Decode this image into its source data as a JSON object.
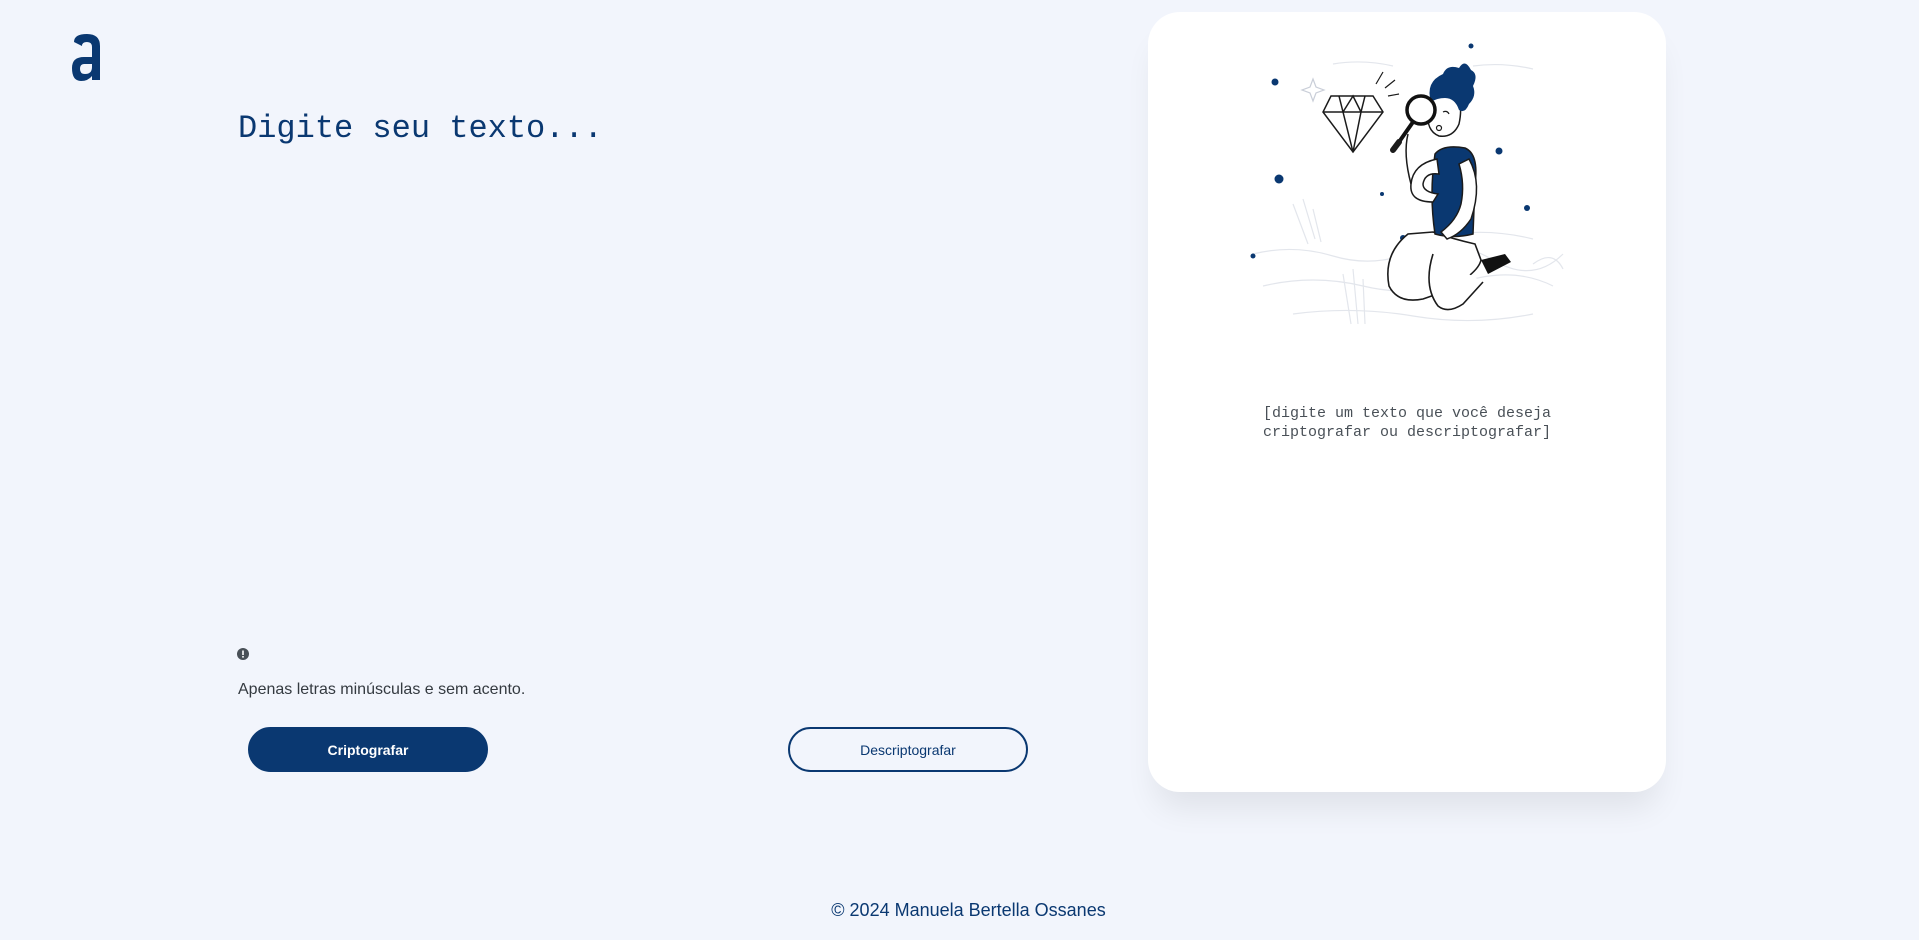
{
  "brand": {
    "logo_letter": "a",
    "color": "#0a3871"
  },
  "editor": {
    "placeholder": "Digite seu texto..."
  },
  "hint": {
    "icon": "info-icon",
    "text": "Apenas letras minúsculas e sem acento."
  },
  "actions": {
    "encrypt_label": "Criptografar",
    "decrypt_label": "Descriptografar"
  },
  "output_panel": {
    "illustration": "person-with-magnifying-glass-and-diamond",
    "message_line1": "[digite um texto que você deseja",
    "message_line2": "criptografar ou descriptografar]"
  },
  "footer": {
    "text": "© 2024 Manuela Bertella Ossanes"
  },
  "colors": {
    "background": "#f2f5fc",
    "accent": "#0a3871",
    "card": "#ffffff",
    "text_muted": "#495057"
  }
}
